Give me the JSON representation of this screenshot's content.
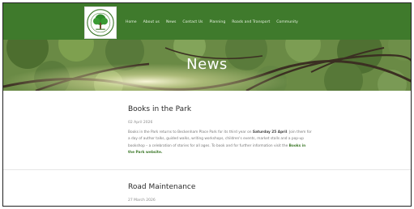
{
  "nav": {
    "items": [
      "Home",
      "About us",
      "News",
      "Contact Us",
      "Planning",
      "Roads and Transport",
      "Community"
    ]
  },
  "logo": {
    "alt": "Beckenham Village logo"
  },
  "hero": {
    "title": "News"
  },
  "articles": [
    {
      "title": "Books in the Park",
      "date": "02 April 2026",
      "body_before": "Books in the Park returns to Beckenham Place Park for its third year on ",
      "body_bold": "Saturday 25 April",
      "body_after": ". Join them for a day of author talks, guided walks, writing workshops, children's events, market stalls and a pop-up bookshop – a celebration of stories for all ages. To book and for further information visit the ",
      "link_text": "Books in the Park website."
    },
    {
      "title": "Road Maintenance",
      "date": "27 March 2026"
    }
  ],
  "colors": {
    "brand_green": "#3f7a2c",
    "nav_text": "#e8f2e2"
  }
}
